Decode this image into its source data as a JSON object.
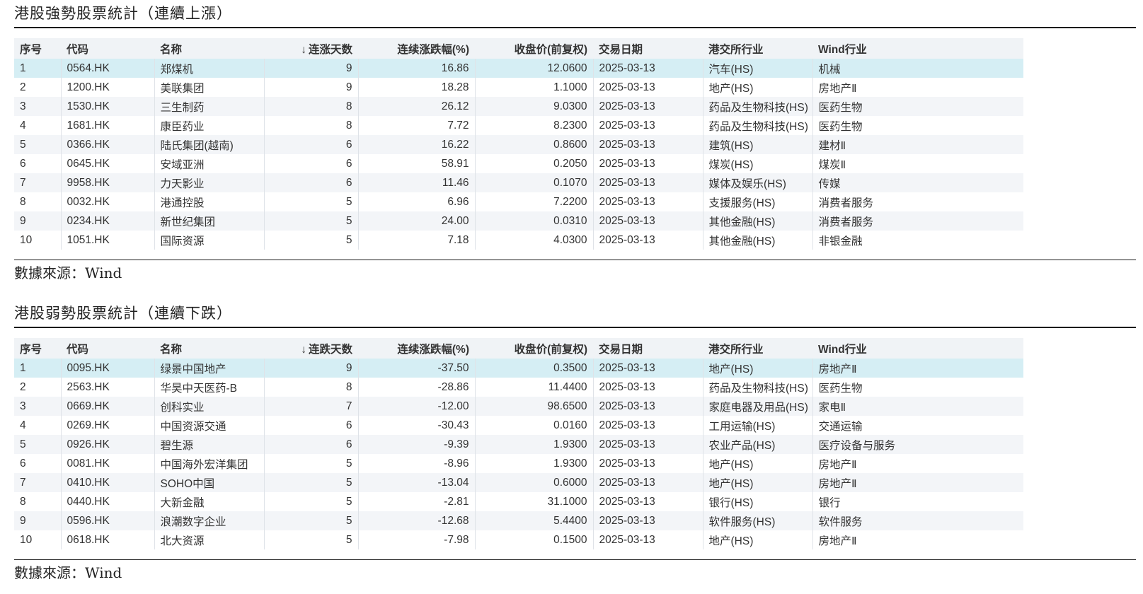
{
  "strong": {
    "title": "港股強勢股票統計（連續上漲）",
    "headers": {
      "idx": "序号",
      "code": "代码",
      "name": "名称",
      "sort_arrow": "↓",
      "days": "连涨天数",
      "pct": "连续涨跌幅(%)",
      "close": "收盘价(前复权)",
      "date": "交易日期",
      "hkex": "港交所行业",
      "wind": "Wind行业"
    },
    "rows": [
      {
        "idx": "1",
        "code": "0564.HK",
        "name": "郑煤机",
        "days": "9",
        "pct": "16.86",
        "close": "12.0600",
        "date": "2025-03-13",
        "hkex": "汽车(HS)",
        "wind": "机械"
      },
      {
        "idx": "2",
        "code": "1200.HK",
        "name": "美联集团",
        "days": "9",
        "pct": "18.28",
        "close": "1.1000",
        "date": "2025-03-13",
        "hkex": "地产(HS)",
        "wind": "房地产Ⅱ"
      },
      {
        "idx": "3",
        "code": "1530.HK",
        "name": "三生制药",
        "days": "8",
        "pct": "26.12",
        "close": "9.0300",
        "date": "2025-03-13",
        "hkex": "药品及生物科技(HS)",
        "wind": "医药生物"
      },
      {
        "idx": "4",
        "code": "1681.HK",
        "name": "康臣药业",
        "days": "8",
        "pct": "7.72",
        "close": "8.2300",
        "date": "2025-03-13",
        "hkex": "药品及生物科技(HS)",
        "wind": "医药生物"
      },
      {
        "idx": "5",
        "code": "0366.HK",
        "name": "陆氏集团(越南)",
        "days": "6",
        "pct": "16.22",
        "close": "0.8600",
        "date": "2025-03-13",
        "hkex": "建筑(HS)",
        "wind": "建材Ⅱ"
      },
      {
        "idx": "6",
        "code": "0645.HK",
        "name": "安域亚洲",
        "days": "6",
        "pct": "58.91",
        "close": "0.2050",
        "date": "2025-03-13",
        "hkex": "煤炭(HS)",
        "wind": "煤炭Ⅱ"
      },
      {
        "idx": "7",
        "code": "9958.HK",
        "name": "力天影业",
        "days": "6",
        "pct": "11.46",
        "close": "0.1070",
        "date": "2025-03-13",
        "hkex": "媒体及娱乐(HS)",
        "wind": "传媒"
      },
      {
        "idx": "8",
        "code": "0032.HK",
        "name": "港通控股",
        "days": "5",
        "pct": "6.96",
        "close": "7.2200",
        "date": "2025-03-13",
        "hkex": "支援服务(HS)",
        "wind": "消费者服务"
      },
      {
        "idx": "9",
        "code": "0234.HK",
        "name": "新世纪集团",
        "days": "5",
        "pct": "24.00",
        "close": "0.0310",
        "date": "2025-03-13",
        "hkex": "其他金融(HS)",
        "wind": "消费者服务"
      },
      {
        "idx": "10",
        "code": "1051.HK",
        "name": "国际资源",
        "days": "5",
        "pct": "7.18",
        "close": "4.0300",
        "date": "2025-03-13",
        "hkex": "其他金融(HS)",
        "wind": "非银金融"
      }
    ],
    "source": "數據來源：Wind"
  },
  "weak": {
    "title": "港股弱勢股票統計（連續下跌）",
    "headers": {
      "idx": "序号",
      "code": "代码",
      "name": "名称",
      "sort_arrow": "↓",
      "days": "连跌天数",
      "pct": "连续涨跌幅(%)",
      "close": "收盘价(前复权)",
      "date": "交易日期",
      "hkex": "港交所行业",
      "wind": "Wind行业"
    },
    "rows": [
      {
        "idx": "1",
        "code": "0095.HK",
        "name": "绿景中国地产",
        "days": "9",
        "pct": "-37.50",
        "close": "0.3500",
        "date": "2025-03-13",
        "hkex": "地产(HS)",
        "wind": "房地产Ⅱ"
      },
      {
        "idx": "2",
        "code": "2563.HK",
        "name": "华昊中天医药-B",
        "days": "8",
        "pct": "-28.86",
        "close": "11.4400",
        "date": "2025-03-13",
        "hkex": "药品及生物科技(HS)",
        "wind": "医药生物"
      },
      {
        "idx": "3",
        "code": "0669.HK",
        "name": "创科实业",
        "days": "7",
        "pct": "-12.00",
        "close": "98.6500",
        "date": "2025-03-13",
        "hkex": "家庭电器及用品(HS)",
        "wind": "家电Ⅱ"
      },
      {
        "idx": "4",
        "code": "0269.HK",
        "name": "中国资源交通",
        "days": "6",
        "pct": "-30.43",
        "close": "0.0160",
        "date": "2025-03-13",
        "hkex": "工用运输(HS)",
        "wind": "交通运输"
      },
      {
        "idx": "5",
        "code": "0926.HK",
        "name": "碧生源",
        "days": "6",
        "pct": "-9.39",
        "close": "1.9300",
        "date": "2025-03-13",
        "hkex": "农业产品(HS)",
        "wind": "医疗设备与服务"
      },
      {
        "idx": "6",
        "code": "0081.HK",
        "name": "中国海外宏洋集团",
        "days": "5",
        "pct": "-8.96",
        "close": "1.9300",
        "date": "2025-03-13",
        "hkex": "地产(HS)",
        "wind": "房地产Ⅱ"
      },
      {
        "idx": "7",
        "code": "0410.HK",
        "name": "SOHO中国",
        "days": "5",
        "pct": "-13.04",
        "close": "0.6000",
        "date": "2025-03-13",
        "hkex": "地产(HS)",
        "wind": "房地产Ⅱ"
      },
      {
        "idx": "8",
        "code": "0440.HK",
        "name": "大新金融",
        "days": "5",
        "pct": "-2.81",
        "close": "31.1000",
        "date": "2025-03-13",
        "hkex": "银行(HS)",
        "wind": "银行"
      },
      {
        "idx": "9",
        "code": "0596.HK",
        "name": "浪潮数字企业",
        "days": "5",
        "pct": "-12.68",
        "close": "5.4400",
        "date": "2025-03-13",
        "hkex": "软件服务(HS)",
        "wind": "软件服务"
      },
      {
        "idx": "10",
        "code": "0618.HK",
        "name": "北大资源",
        "days": "5",
        "pct": "-7.98",
        "close": "0.1500",
        "date": "2025-03-13",
        "hkex": "地产(HS)",
        "wind": "房地产Ⅱ"
      }
    ],
    "source": "數據來源：Wind"
  }
}
